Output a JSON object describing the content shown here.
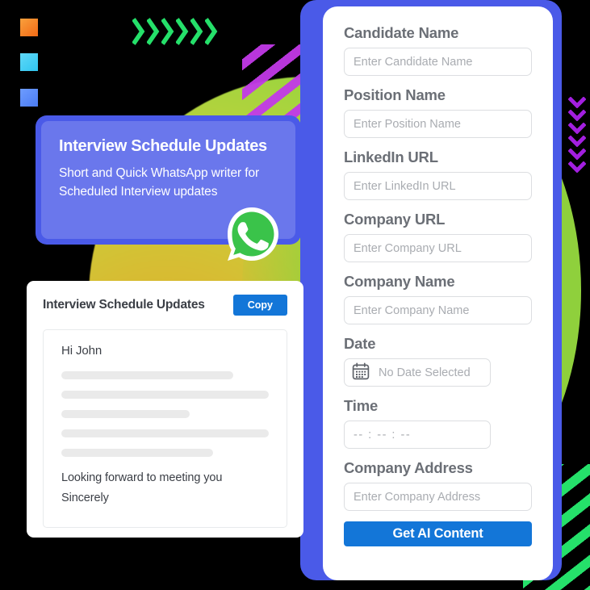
{
  "decor": {
    "squares": [
      {
        "name": "orange-square",
        "color": "#f26a16"
      },
      {
        "name": "cyan-square",
        "color": "#30c5f0"
      },
      {
        "name": "blue-square",
        "color": "#4b7cf3"
      }
    ],
    "chevron_right_count": 6,
    "chevron_right_color": "#25e06a",
    "chevron_down_count": 6,
    "chevron_down_color": "#a31fe0",
    "stripes_magenta_color": "#c239e8",
    "stripes_green_color": "#25e06a",
    "blob_gradient": [
      "#e0a92c",
      "#c9cf3a",
      "#86d63f"
    ]
  },
  "promo": {
    "title": "Interview Schedule Updates",
    "subtitle": "Short and Quick WhatsApp writer for Scheduled Interview updates",
    "badge_icon": "whatsapp-icon",
    "accent_color": "#4a5ae8"
  },
  "preview": {
    "title": "Interview Schedule Updates",
    "copy_label": "Copy",
    "greeting": "Hi John",
    "skeleton_widths": [
      "83%",
      "100%",
      "62%",
      "100%",
      "73%"
    ],
    "closing_line_1": "Looking forward to meeting you",
    "closing_line_2": "Sincerely",
    "button_color": "#1376d8"
  },
  "form": {
    "accent_color": "#4a5ae8",
    "submit_label": "Get AI Content",
    "submit_color": "#1376d8",
    "fields": [
      {
        "label": "Candidate Name",
        "placeholder": "Enter Candidate Name",
        "type": "text"
      },
      {
        "label": "Position Name",
        "placeholder": "Enter Position Name",
        "type": "text"
      },
      {
        "label": "LinkedIn URL",
        "placeholder": "Enter LinkedIn URL",
        "type": "text"
      },
      {
        "label": "Company URL",
        "placeholder": "Enter Company URL",
        "type": "text"
      },
      {
        "label": "Company Name",
        "placeholder": "Enter Company Name",
        "type": "text"
      },
      {
        "label": "Date",
        "placeholder": "No Date Selected",
        "type": "date",
        "icon": "calendar-icon"
      },
      {
        "label": "Time",
        "placeholder": "-- : -- : --",
        "type": "time"
      },
      {
        "label": "Company Address",
        "placeholder": "Enter Company Address",
        "type": "text"
      }
    ]
  }
}
